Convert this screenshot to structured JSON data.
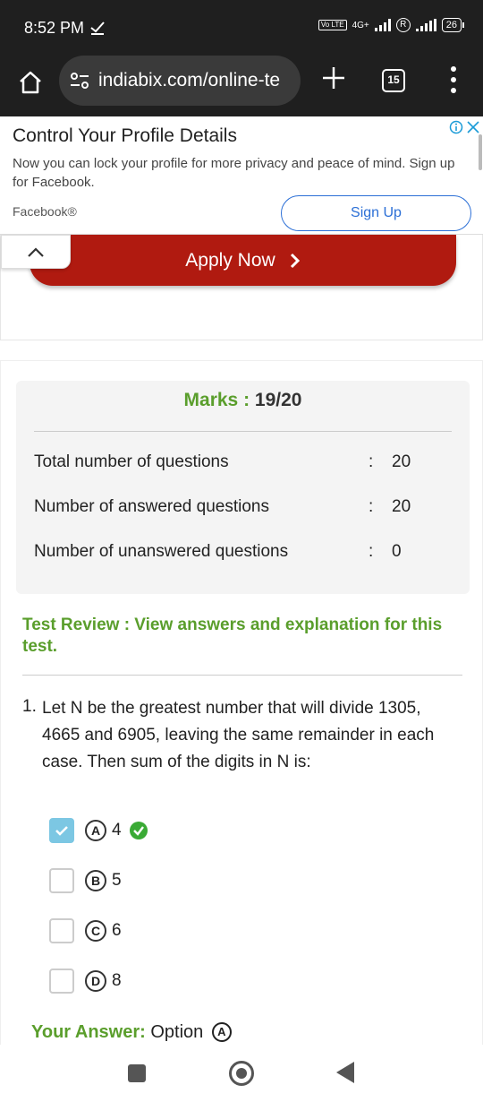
{
  "status_bar": {
    "time": "8:52 PM",
    "network": "4G+",
    "volte": "Vo LTE",
    "battery": "26"
  },
  "browser": {
    "url": "indiabix.com/online-te",
    "tab_count": "15"
  },
  "ad": {
    "title": "Control Your Profile Details",
    "body": "Now you can lock your profile for more privacy and peace of mind. Sign up for Facebook.",
    "source": "Facebook®",
    "cta": "Sign Up"
  },
  "apply": {
    "label": "Apply Now",
    "chevron": "›"
  },
  "results": {
    "marks_label": "Marks :",
    "marks_value": "19/20",
    "stats": [
      {
        "label": "Total number of questions",
        "value": "20"
      },
      {
        "label": "Number of answered questions",
        "value": "20"
      },
      {
        "label": "Number of unanswered questions",
        "value": "0"
      }
    ],
    "colon": ":"
  },
  "review": {
    "title": "Test Review : View answers and explanation for this test."
  },
  "question": {
    "number": "1.",
    "text": "Let N be the greatest number that will divide 1305, 4665 and 6905, leaving the same remainder in each case. Then sum of the digits in N is:",
    "options": [
      {
        "letter": "A",
        "value": "4",
        "checked": true,
        "correct": true
      },
      {
        "letter": "B",
        "value": "5",
        "checked": false,
        "correct": false
      },
      {
        "letter": "C",
        "value": "6",
        "checked": false,
        "correct": false
      },
      {
        "letter": "D",
        "value": "8",
        "checked": false,
        "correct": false
      }
    ]
  },
  "your_answer": {
    "label": "Your Answer:",
    "text": "Option",
    "letter": "A"
  },
  "colors": {
    "accent_green": "#5a9e2c",
    "apply_red": "#b01a10",
    "link_blue": "#2b6fd6",
    "check_blue": "#7cc7e3"
  }
}
